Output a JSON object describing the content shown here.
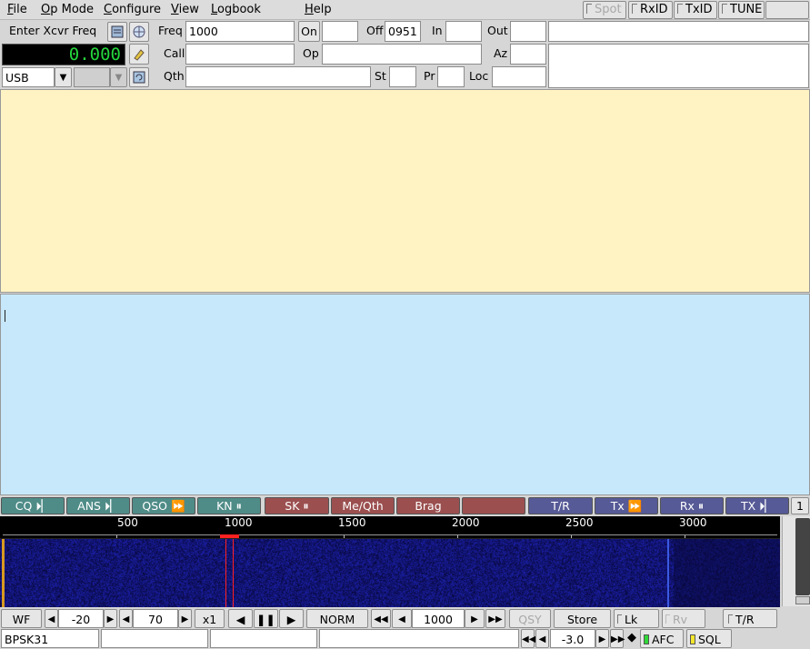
{
  "menubar": {
    "items": [
      {
        "pre": "",
        "u": "F",
        "post": "ile"
      },
      {
        "pre": "",
        "u": "O",
        "post": "p Mode"
      },
      {
        "pre": "",
        "u": "C",
        "post": "onfigure"
      },
      {
        "pre": "",
        "u": "V",
        "post": "iew"
      },
      {
        "pre": "",
        "u": "L",
        "post": "ogbook"
      },
      {
        "pre": "",
        "u": "H",
        "post": "elp"
      }
    ],
    "spot": "Spot",
    "rxid": "RxID",
    "txid": "TxID",
    "tune": "TUNE"
  },
  "rig": {
    "enter_label": "Enter Xcvr Freq",
    "freq_display": "0.000",
    "mode": "USB",
    "bandwidth": ""
  },
  "log": {
    "freq_label": "Freq",
    "freq_value": "1000",
    "on_label": "On",
    "on_value": "",
    "off_label": "Off",
    "off_value": "0951",
    "in_label": "In",
    "in_value": "",
    "out_label": "Out",
    "out_value": "",
    "call_label": "Call",
    "call_value": "",
    "op_label": "Op",
    "op_value": "",
    "az_label": "Az",
    "az_value": "",
    "qth_label": "Qth",
    "qth_value": "",
    "st_label": "St",
    "st_value": "",
    "pr_label": "Pr",
    "pr_value": "",
    "loc_label": "Loc",
    "loc_value": "",
    "notes1": "",
    "notes2": ""
  },
  "rx_text": "",
  "tx_text": "",
  "macros": [
    {
      "label": "CQ",
      "icon": "⏵▏",
      "color": "green"
    },
    {
      "label": "ANS",
      "icon": "⏵▏",
      "color": "green"
    },
    {
      "label": "QSO",
      "icon": "⏩",
      "color": "green"
    },
    {
      "label": "KN",
      "icon": "⏸",
      "color": "green"
    },
    {
      "label": "SK",
      "icon": "⏸",
      "color": "red"
    },
    {
      "label": "Me/Qth",
      "icon": "",
      "color": "red"
    },
    {
      "label": "Brag",
      "icon": "",
      "color": "red"
    },
    {
      "label": "",
      "icon": "",
      "color": "red"
    },
    {
      "label": "T/R",
      "icon": "",
      "color": "blue"
    },
    {
      "label": "Tx",
      "icon": "⏩",
      "color": "blue"
    },
    {
      "label": "Rx",
      "icon": "⏸",
      "color": "blue"
    },
    {
      "label": "TX",
      "icon": "⏵▏",
      "color": "blue"
    }
  ],
  "macro_set": "1",
  "scale": {
    "ticks": [
      "500",
      "1000",
      "1500",
      "2000",
      "2500",
      "3000"
    ],
    "marker": "1000"
  },
  "controls": {
    "wf": "WF",
    "ref_level": "-20",
    "ampl_span": "70",
    "zoom": "x1",
    "speed": "NORM",
    "carrier": "1000",
    "qsy": "QSY",
    "store": "Store",
    "lk": "Lk",
    "rv": "Rv",
    "tr": "T/R"
  },
  "status": {
    "mode": "BPSK31",
    "s1": "",
    "s2": "",
    "s3": "",
    "squelch": "-3.0",
    "afc": "AFC",
    "sql": "SQL"
  },
  "colors": {
    "rx_bg": "#fff3c4",
    "tx_bg": "#c7e8fb",
    "waterfall": "#0c0c48",
    "freq_digits": "#24d63c",
    "cursor": "#ff2020"
  }
}
